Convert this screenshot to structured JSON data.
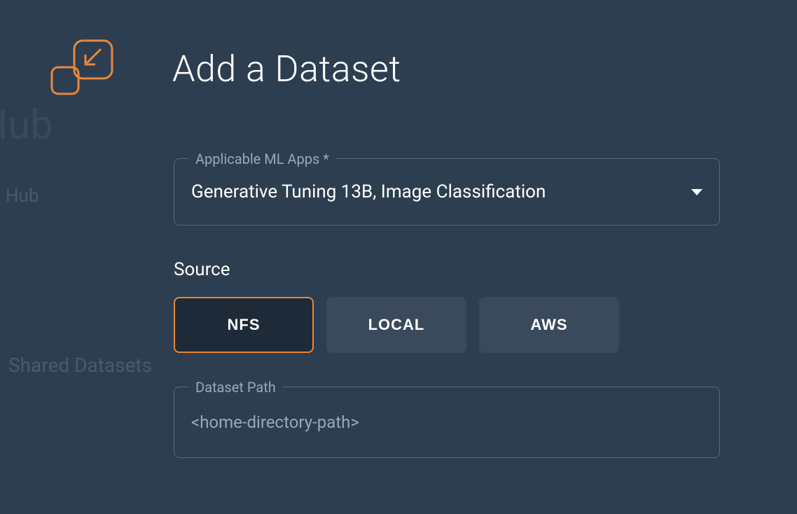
{
  "background": {
    "hub_large": "Hub",
    "hub_small": "Hub",
    "shared_datasets": "Shared Datasets"
  },
  "header": {
    "title": "Add a Dataset"
  },
  "form": {
    "ml_apps": {
      "label": "Applicable ML Apps *",
      "value": "Generative Tuning 13B, Image Classification"
    },
    "source": {
      "label": "Source",
      "options": [
        {
          "label": "NFS",
          "active": true
        },
        {
          "label": "LOCAL",
          "active": false
        },
        {
          "label": "AWS",
          "active": false
        }
      ]
    },
    "dataset_path": {
      "label": "Dataset Path",
      "placeholder": "<home-directory-path>"
    }
  }
}
